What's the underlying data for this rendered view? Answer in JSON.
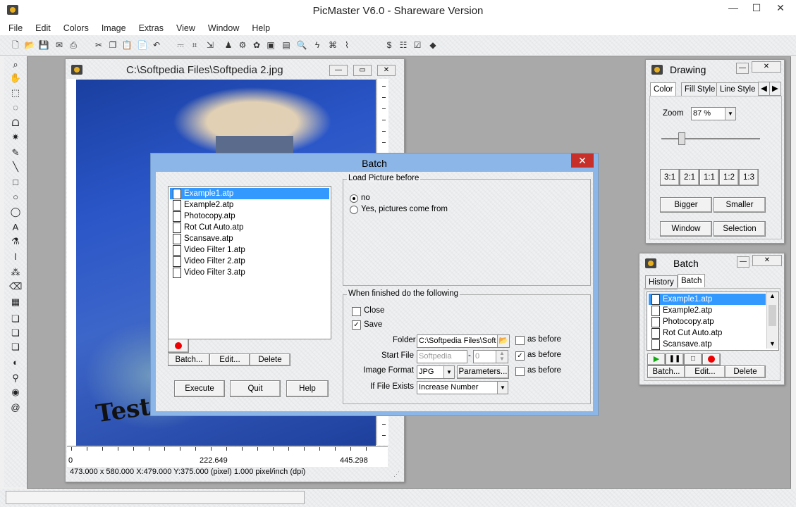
{
  "app": {
    "title": "PicMaster V6.0 - Shareware Version",
    "caption_buttons": {
      "minimize": "—",
      "maximize": "☐",
      "close": "✕"
    }
  },
  "menu": [
    "File",
    "Edit",
    "Colors",
    "Image",
    "Extras",
    "View",
    "Window",
    "Help"
  ],
  "toolbar_icons": [
    {
      "name": "new-icon",
      "glyph": "🗋"
    },
    {
      "name": "open-icon",
      "glyph": "📂"
    },
    {
      "name": "save-icon",
      "glyph": "💾"
    },
    {
      "name": "mail-icon",
      "glyph": "✉"
    },
    {
      "name": "print-icon",
      "glyph": "⎙"
    },
    {
      "name": "cut-icon",
      "glyph": "✂"
    },
    {
      "name": "copy-icon",
      "glyph": "❐"
    },
    {
      "name": "paste-icon",
      "glyph": "📋"
    },
    {
      "name": "paste-new-icon",
      "glyph": "📄"
    },
    {
      "name": "undo-icon",
      "glyph": "↶"
    },
    {
      "name": "scan-icon",
      "glyph": "⎓"
    },
    {
      "name": "crop-icon",
      "glyph": "⌗"
    },
    {
      "name": "resize-icon",
      "glyph": "⇲"
    },
    {
      "name": "stamp-icon",
      "glyph": "♟"
    },
    {
      "name": "fx-icon",
      "glyph": "⚙"
    },
    {
      "name": "color-wheel-icon",
      "glyph": "✿"
    },
    {
      "name": "slideshow-icon",
      "glyph": "▣"
    },
    {
      "name": "batch-icon",
      "glyph": "▤"
    },
    {
      "name": "zoom-icon",
      "glyph": "🔍"
    },
    {
      "name": "flash-icon",
      "glyph": "ϟ"
    },
    {
      "name": "filter-icon",
      "glyph": "⌘"
    },
    {
      "name": "clip-icon",
      "glyph": "⌇"
    },
    {
      "name": "dollar-icon",
      "glyph": "$"
    },
    {
      "name": "list-icon",
      "glyph": "☷"
    },
    {
      "name": "checklist-icon",
      "glyph": "☑"
    },
    {
      "name": "book-icon",
      "glyph": "◆"
    }
  ],
  "left_tools": [
    {
      "name": "zoom-tool-icon",
      "glyph": "⌕"
    },
    {
      "name": "hand-tool-icon",
      "glyph": "✋"
    },
    {
      "name": "rect-select-icon",
      "glyph": "⬚"
    },
    {
      "name": "ellipse-select-icon",
      "glyph": "◌"
    },
    {
      "name": "lasso-icon",
      "glyph": "ᗝ"
    },
    {
      "name": "magic-wand-icon",
      "glyph": "✷"
    },
    {
      "name": "pencil-icon",
      "glyph": "✎"
    },
    {
      "name": "line-icon",
      "glyph": "╲"
    },
    {
      "name": "rectangle-icon",
      "glyph": "□"
    },
    {
      "name": "circle-icon",
      "glyph": "○"
    },
    {
      "name": "ellipse-icon",
      "glyph": "◯"
    },
    {
      "name": "text-tool-icon",
      "glyph": "A"
    },
    {
      "name": "fill-icon",
      "glyph": "⚗"
    },
    {
      "name": "brush-icon",
      "glyph": "ǀ"
    },
    {
      "name": "spray-icon",
      "glyph": "⁂"
    },
    {
      "name": "eraser-icon",
      "glyph": "⌫"
    },
    {
      "name": "pattern-icon",
      "glyph": "▦"
    },
    {
      "name": "clone-icon",
      "glyph": "❏"
    },
    {
      "name": "smudge-icon",
      "glyph": "❏"
    },
    {
      "name": "sharpen-icon",
      "glyph": "❏"
    },
    {
      "name": "color-replace-icon",
      "glyph": "◐"
    },
    {
      "name": "eyedropper-icon",
      "glyph": "⚲"
    },
    {
      "name": "redeye-icon",
      "glyph": "◉"
    },
    {
      "name": "annotation-icon",
      "glyph": "@"
    }
  ],
  "image_window": {
    "title": "C:\\Softpedia Files\\Softpedia 2.jpg",
    "ruler_h_labels": [
      "0",
      "222.649",
      "445.298"
    ],
    "status": "473.000 x 580.000   X:479.000  Y:375.000 (pixel)  1.000 pixel/inch (dpi)",
    "scribble": "Test"
  },
  "batch_dialog": {
    "title": "Batch",
    "close": "✕",
    "files": [
      "Example1.atp",
      "Example2.atp",
      "Photocopy.atp",
      "Rot Cut Auto.atp",
      "Scansave.atp",
      "Video Filter 1.atp",
      "Video Filter 2.atp",
      "Video Filter 3.atp"
    ],
    "selected_index": 0,
    "list_buttons": {
      "batch": "Batch...",
      "edit": "Edit...",
      "delete": "Delete"
    },
    "load_group": {
      "label": "Load Picture before",
      "opt_no": "no",
      "opt_yes": "Yes, pictures come from"
    },
    "finish_group": {
      "label": "When finished do the following",
      "close": "Close",
      "save": "Save",
      "folder_label": "Folder",
      "folder_value": "C:\\Softpedia Files\\Soft",
      "start_file_label": "Start File",
      "start_file_value": "Softpedia",
      "start_num_sep": "-",
      "start_num_value": "0",
      "image_format_label": "Image Format",
      "image_format_value": "JPG",
      "parameters": "Parameters...",
      "if_exists_label": "If File Exists",
      "if_exists_value": "Increase Number",
      "as_before": "as before"
    },
    "actions": {
      "execute": "Execute",
      "quit": "Quit",
      "help": "Help"
    }
  },
  "drawing_panel": {
    "title": "Drawing",
    "tabs": [
      "Color",
      "Fill Style",
      "Line Style"
    ],
    "zoom_label": "Zoom",
    "zoom_value": "87 %",
    "zoom_slider_fraction": 0.2,
    "ratio_buttons": [
      "3:1",
      "2:1",
      "1:1",
      "1:2",
      "1:3"
    ],
    "bigger": "Bigger",
    "smaller": "Smaller",
    "window": "Window",
    "selection": "Selection"
  },
  "batch_panel": {
    "title": "Batch",
    "tabs": [
      "History",
      "Batch"
    ],
    "files": [
      "Example1.atp",
      "Example2.atp",
      "Photocopy.atp",
      "Rot Cut Auto.atp",
      "Scansave.atp"
    ],
    "buttons": {
      "batch": "Batch...",
      "edit": "Edit...",
      "delete": "Delete"
    }
  }
}
